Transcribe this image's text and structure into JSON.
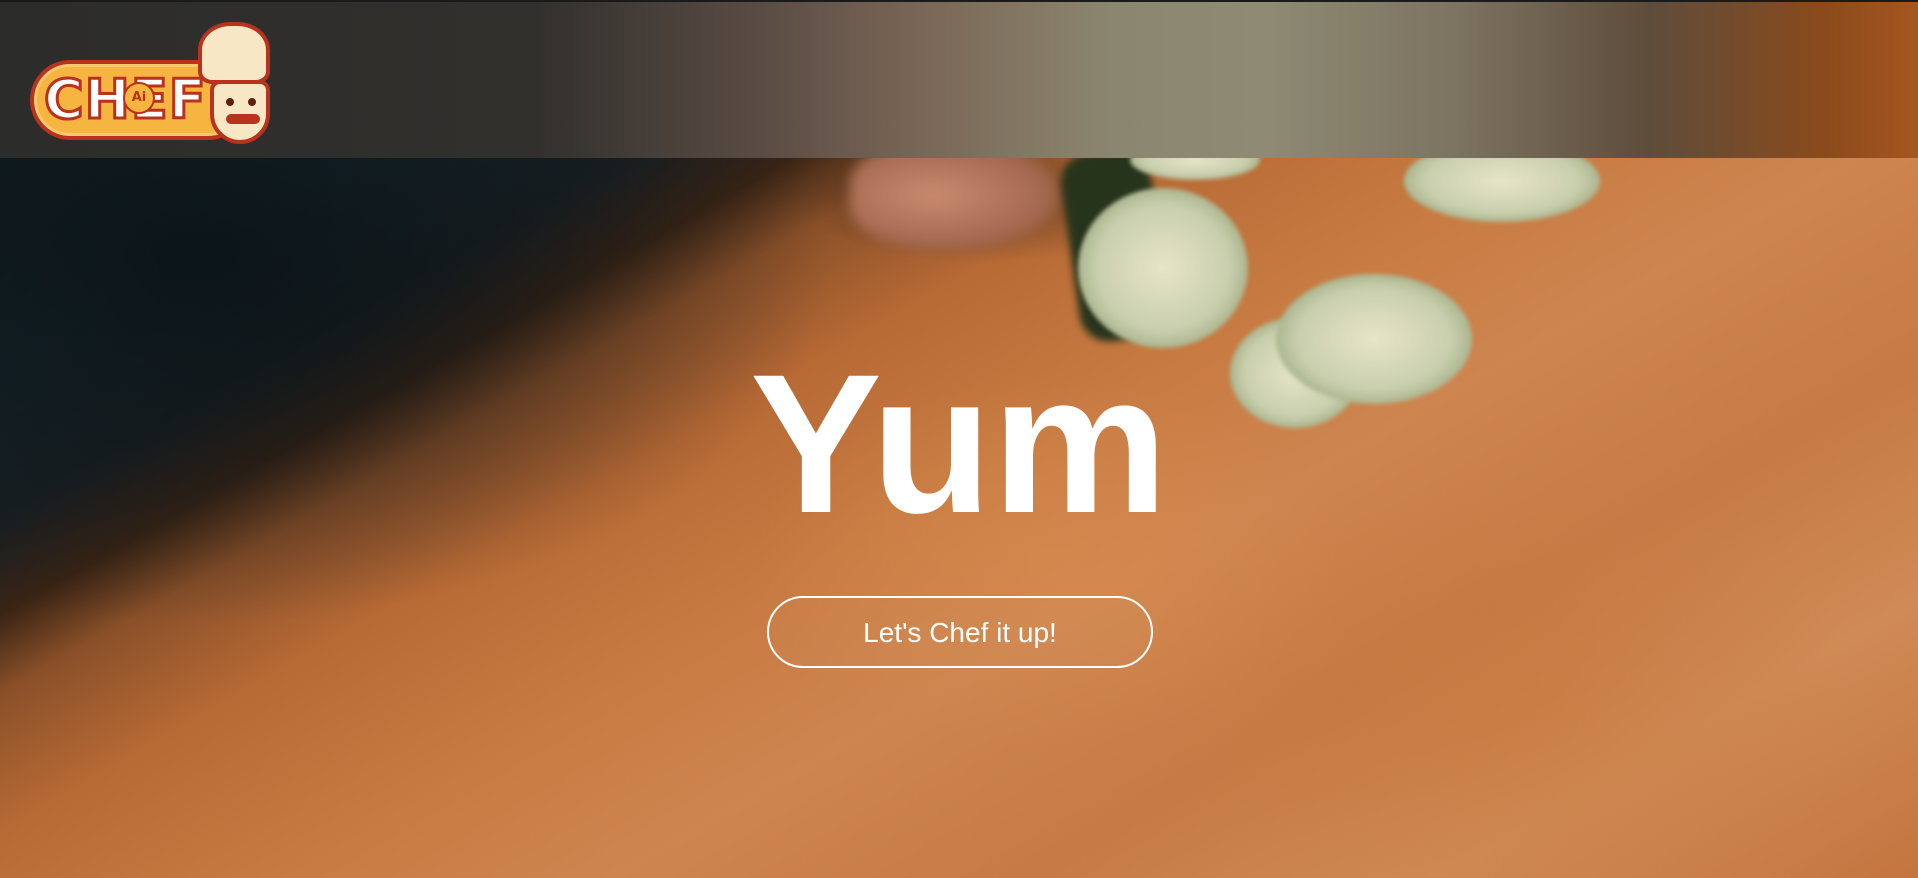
{
  "header": {
    "logo": {
      "alt_text": "CHEF",
      "badge": "Ai",
      "icon": "chef-mascot-logo",
      "colors": {
        "fill": "#f6b441",
        "outline": "#b8321d",
        "text": "#ffffff"
      }
    }
  },
  "hero": {
    "title": "Yum",
    "cta_label": "Let's Chef it up!",
    "background": "blurred cutting board with cucumber slices",
    "colors": {
      "text": "#ffffff",
      "wood": "#c77b42"
    }
  }
}
